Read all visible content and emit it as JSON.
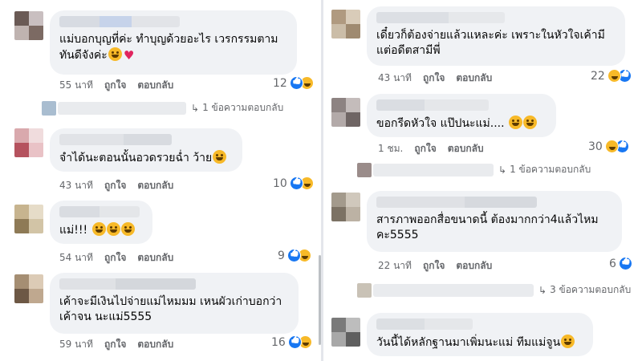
{
  "actions": {
    "like": "ถูกใจ",
    "reply": "ตอบกลับ"
  },
  "left_comments": [
    {
      "text": "แม่บอกบุญที่ค่ะ ทำบุญด้วยอะไร เวรกรรมตาม ทันดีจังค่ะ",
      "time": "55 นาที",
      "reactions": "12"
    },
    {
      "text": "จำได้นะตอนนั้นอวดรวยฉ่ำ ว้าย",
      "time": "43 นาที",
      "reactions": "10"
    },
    {
      "text": "แม่!!!",
      "time": "54 นาที",
      "reactions": "9"
    },
    {
      "text": "เค้าจะมีเงินไปจ่ายแม่ไหมมม เหนผัวเก่าบอกว่า เค้าจน นะแม่5555",
      "time": "59 นาที",
      "reactions": "16"
    }
  ],
  "left_replies": {
    "label": "1 ข้อความตอบกลับ"
  },
  "right_comments": [
    {
      "text": "เดี๋ยวก็ต้องจ่ายแล้วแหละค่ะ เพราะในหัวใจเค้ามี แต่อดีตสามีพี่",
      "time": "43 นาที",
      "reactions": "22"
    },
    {
      "text": "ขอกรีดหัวใจ แป๊ปนะแม่....",
      "time": "1 ชม.",
      "reactions": "30"
    },
    {
      "text": "สารภาพออกสื่อขนาดนี้ ต้องมากกว่า4แล้วไหม คะ5555",
      "time": "22 นาที",
      "reactions": "6"
    },
    {
      "text": "วันนี้ได้หลักฐานมาเพิ่มนะแม่ ทีมแม่จูน",
      "time": "",
      "reactions": ""
    }
  ],
  "right_replies": [
    {
      "label": "1 ข้อความตอบกลับ"
    },
    {
      "label": "3 ข้อความตอบกลับ"
    }
  ],
  "colors": {
    "bubble": "#f0f2f5",
    "meta": "#65676b",
    "like": "#1877f2",
    "haha": "#f7b928",
    "heart": "#e0245e"
  },
  "icons": [
    "like-reaction-icon",
    "haha-reaction-icon",
    "grinning-sweat-emoji",
    "heart-emoji",
    "relieved-emoji",
    "laughing-emoji",
    "blush-emoji"
  ]
}
